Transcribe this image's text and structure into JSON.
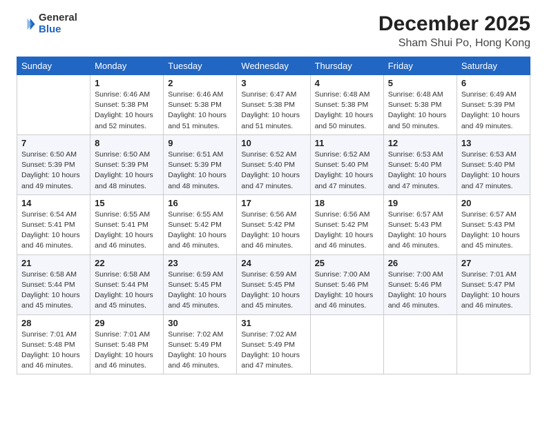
{
  "header": {
    "logo": {
      "general": "General",
      "blue": "Blue"
    },
    "title": "December 2025",
    "subtitle": "Sham Shui Po, Hong Kong"
  },
  "columns": [
    "Sunday",
    "Monday",
    "Tuesday",
    "Wednesday",
    "Thursday",
    "Friday",
    "Saturday"
  ],
  "weeks": [
    [
      {
        "day": "",
        "info": ""
      },
      {
        "day": "1",
        "info": "Sunrise: 6:46 AM\nSunset: 5:38 PM\nDaylight: 10 hours\nand 52 minutes."
      },
      {
        "day": "2",
        "info": "Sunrise: 6:46 AM\nSunset: 5:38 PM\nDaylight: 10 hours\nand 51 minutes."
      },
      {
        "day": "3",
        "info": "Sunrise: 6:47 AM\nSunset: 5:38 PM\nDaylight: 10 hours\nand 51 minutes."
      },
      {
        "day": "4",
        "info": "Sunrise: 6:48 AM\nSunset: 5:38 PM\nDaylight: 10 hours\nand 50 minutes."
      },
      {
        "day": "5",
        "info": "Sunrise: 6:48 AM\nSunset: 5:38 PM\nDaylight: 10 hours\nand 50 minutes."
      },
      {
        "day": "6",
        "info": "Sunrise: 6:49 AM\nSunset: 5:39 PM\nDaylight: 10 hours\nand 49 minutes."
      }
    ],
    [
      {
        "day": "7",
        "info": "Sunrise: 6:50 AM\nSunset: 5:39 PM\nDaylight: 10 hours\nand 49 minutes."
      },
      {
        "day": "8",
        "info": "Sunrise: 6:50 AM\nSunset: 5:39 PM\nDaylight: 10 hours\nand 48 minutes."
      },
      {
        "day": "9",
        "info": "Sunrise: 6:51 AM\nSunset: 5:39 PM\nDaylight: 10 hours\nand 48 minutes."
      },
      {
        "day": "10",
        "info": "Sunrise: 6:52 AM\nSunset: 5:40 PM\nDaylight: 10 hours\nand 47 minutes."
      },
      {
        "day": "11",
        "info": "Sunrise: 6:52 AM\nSunset: 5:40 PM\nDaylight: 10 hours\nand 47 minutes."
      },
      {
        "day": "12",
        "info": "Sunrise: 6:53 AM\nSunset: 5:40 PM\nDaylight: 10 hours\nand 47 minutes."
      },
      {
        "day": "13",
        "info": "Sunrise: 6:53 AM\nSunset: 5:40 PM\nDaylight: 10 hours\nand 47 minutes."
      }
    ],
    [
      {
        "day": "14",
        "info": "Sunrise: 6:54 AM\nSunset: 5:41 PM\nDaylight: 10 hours\nand 46 minutes."
      },
      {
        "day": "15",
        "info": "Sunrise: 6:55 AM\nSunset: 5:41 PM\nDaylight: 10 hours\nand 46 minutes."
      },
      {
        "day": "16",
        "info": "Sunrise: 6:55 AM\nSunset: 5:42 PM\nDaylight: 10 hours\nand 46 minutes."
      },
      {
        "day": "17",
        "info": "Sunrise: 6:56 AM\nSunset: 5:42 PM\nDaylight: 10 hours\nand 46 minutes."
      },
      {
        "day": "18",
        "info": "Sunrise: 6:56 AM\nSunset: 5:42 PM\nDaylight: 10 hours\nand 46 minutes."
      },
      {
        "day": "19",
        "info": "Sunrise: 6:57 AM\nSunset: 5:43 PM\nDaylight: 10 hours\nand 46 minutes."
      },
      {
        "day": "20",
        "info": "Sunrise: 6:57 AM\nSunset: 5:43 PM\nDaylight: 10 hours\nand 45 minutes."
      }
    ],
    [
      {
        "day": "21",
        "info": "Sunrise: 6:58 AM\nSunset: 5:44 PM\nDaylight: 10 hours\nand 45 minutes."
      },
      {
        "day": "22",
        "info": "Sunrise: 6:58 AM\nSunset: 5:44 PM\nDaylight: 10 hours\nand 45 minutes."
      },
      {
        "day": "23",
        "info": "Sunrise: 6:59 AM\nSunset: 5:45 PM\nDaylight: 10 hours\nand 45 minutes."
      },
      {
        "day": "24",
        "info": "Sunrise: 6:59 AM\nSunset: 5:45 PM\nDaylight: 10 hours\nand 45 minutes."
      },
      {
        "day": "25",
        "info": "Sunrise: 7:00 AM\nSunset: 5:46 PM\nDaylight: 10 hours\nand 46 minutes."
      },
      {
        "day": "26",
        "info": "Sunrise: 7:00 AM\nSunset: 5:46 PM\nDaylight: 10 hours\nand 46 minutes."
      },
      {
        "day": "27",
        "info": "Sunrise: 7:01 AM\nSunset: 5:47 PM\nDaylight: 10 hours\nand 46 minutes."
      }
    ],
    [
      {
        "day": "28",
        "info": "Sunrise: 7:01 AM\nSunset: 5:48 PM\nDaylight: 10 hours\nand 46 minutes."
      },
      {
        "day": "29",
        "info": "Sunrise: 7:01 AM\nSunset: 5:48 PM\nDaylight: 10 hours\nand 46 minutes."
      },
      {
        "day": "30",
        "info": "Sunrise: 7:02 AM\nSunset: 5:49 PM\nDaylight: 10 hours\nand 46 minutes."
      },
      {
        "day": "31",
        "info": "Sunrise: 7:02 AM\nSunset: 5:49 PM\nDaylight: 10 hours\nand 47 minutes."
      },
      {
        "day": "",
        "info": ""
      },
      {
        "day": "",
        "info": ""
      },
      {
        "day": "",
        "info": ""
      }
    ]
  ]
}
